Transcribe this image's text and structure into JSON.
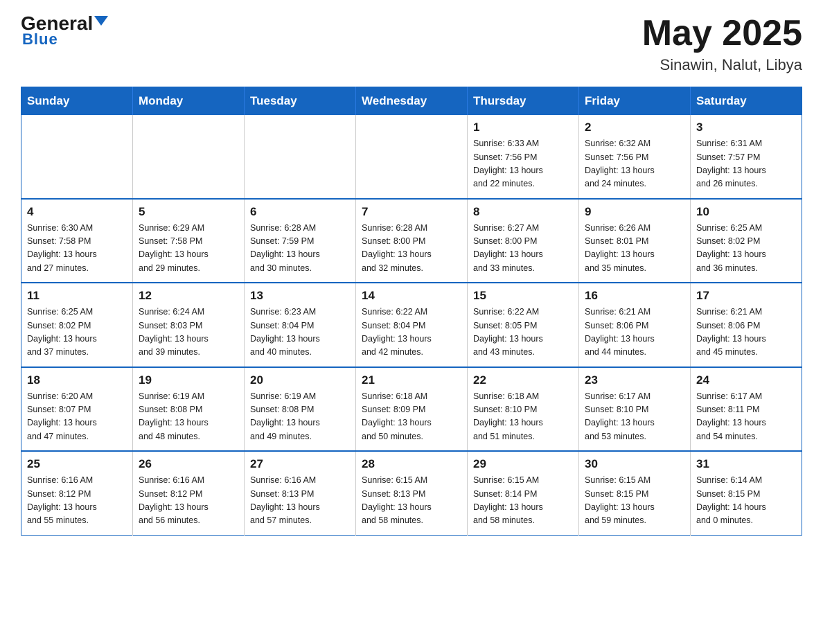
{
  "header": {
    "logo_general": "General",
    "logo_blue": "Blue",
    "title": "May 2025",
    "subtitle": "Sinawin, Nalut, Libya"
  },
  "calendar": {
    "days_of_week": [
      "Sunday",
      "Monday",
      "Tuesday",
      "Wednesday",
      "Thursday",
      "Friday",
      "Saturday"
    ],
    "weeks": [
      [
        {
          "day": "",
          "info": ""
        },
        {
          "day": "",
          "info": ""
        },
        {
          "day": "",
          "info": ""
        },
        {
          "day": "",
          "info": ""
        },
        {
          "day": "1",
          "info": "Sunrise: 6:33 AM\nSunset: 7:56 PM\nDaylight: 13 hours\nand 22 minutes."
        },
        {
          "day": "2",
          "info": "Sunrise: 6:32 AM\nSunset: 7:56 PM\nDaylight: 13 hours\nand 24 minutes."
        },
        {
          "day": "3",
          "info": "Sunrise: 6:31 AM\nSunset: 7:57 PM\nDaylight: 13 hours\nand 26 minutes."
        }
      ],
      [
        {
          "day": "4",
          "info": "Sunrise: 6:30 AM\nSunset: 7:58 PM\nDaylight: 13 hours\nand 27 minutes."
        },
        {
          "day": "5",
          "info": "Sunrise: 6:29 AM\nSunset: 7:58 PM\nDaylight: 13 hours\nand 29 minutes."
        },
        {
          "day": "6",
          "info": "Sunrise: 6:28 AM\nSunset: 7:59 PM\nDaylight: 13 hours\nand 30 minutes."
        },
        {
          "day": "7",
          "info": "Sunrise: 6:28 AM\nSunset: 8:00 PM\nDaylight: 13 hours\nand 32 minutes."
        },
        {
          "day": "8",
          "info": "Sunrise: 6:27 AM\nSunset: 8:00 PM\nDaylight: 13 hours\nand 33 minutes."
        },
        {
          "day": "9",
          "info": "Sunrise: 6:26 AM\nSunset: 8:01 PM\nDaylight: 13 hours\nand 35 minutes."
        },
        {
          "day": "10",
          "info": "Sunrise: 6:25 AM\nSunset: 8:02 PM\nDaylight: 13 hours\nand 36 minutes."
        }
      ],
      [
        {
          "day": "11",
          "info": "Sunrise: 6:25 AM\nSunset: 8:02 PM\nDaylight: 13 hours\nand 37 minutes."
        },
        {
          "day": "12",
          "info": "Sunrise: 6:24 AM\nSunset: 8:03 PM\nDaylight: 13 hours\nand 39 minutes."
        },
        {
          "day": "13",
          "info": "Sunrise: 6:23 AM\nSunset: 8:04 PM\nDaylight: 13 hours\nand 40 minutes."
        },
        {
          "day": "14",
          "info": "Sunrise: 6:22 AM\nSunset: 8:04 PM\nDaylight: 13 hours\nand 42 minutes."
        },
        {
          "day": "15",
          "info": "Sunrise: 6:22 AM\nSunset: 8:05 PM\nDaylight: 13 hours\nand 43 minutes."
        },
        {
          "day": "16",
          "info": "Sunrise: 6:21 AM\nSunset: 8:06 PM\nDaylight: 13 hours\nand 44 minutes."
        },
        {
          "day": "17",
          "info": "Sunrise: 6:21 AM\nSunset: 8:06 PM\nDaylight: 13 hours\nand 45 minutes."
        }
      ],
      [
        {
          "day": "18",
          "info": "Sunrise: 6:20 AM\nSunset: 8:07 PM\nDaylight: 13 hours\nand 47 minutes."
        },
        {
          "day": "19",
          "info": "Sunrise: 6:19 AM\nSunset: 8:08 PM\nDaylight: 13 hours\nand 48 minutes."
        },
        {
          "day": "20",
          "info": "Sunrise: 6:19 AM\nSunset: 8:08 PM\nDaylight: 13 hours\nand 49 minutes."
        },
        {
          "day": "21",
          "info": "Sunrise: 6:18 AM\nSunset: 8:09 PM\nDaylight: 13 hours\nand 50 minutes."
        },
        {
          "day": "22",
          "info": "Sunrise: 6:18 AM\nSunset: 8:10 PM\nDaylight: 13 hours\nand 51 minutes."
        },
        {
          "day": "23",
          "info": "Sunrise: 6:17 AM\nSunset: 8:10 PM\nDaylight: 13 hours\nand 53 minutes."
        },
        {
          "day": "24",
          "info": "Sunrise: 6:17 AM\nSunset: 8:11 PM\nDaylight: 13 hours\nand 54 minutes."
        }
      ],
      [
        {
          "day": "25",
          "info": "Sunrise: 6:16 AM\nSunset: 8:12 PM\nDaylight: 13 hours\nand 55 minutes."
        },
        {
          "day": "26",
          "info": "Sunrise: 6:16 AM\nSunset: 8:12 PM\nDaylight: 13 hours\nand 56 minutes."
        },
        {
          "day": "27",
          "info": "Sunrise: 6:16 AM\nSunset: 8:13 PM\nDaylight: 13 hours\nand 57 minutes."
        },
        {
          "day": "28",
          "info": "Sunrise: 6:15 AM\nSunset: 8:13 PM\nDaylight: 13 hours\nand 58 minutes."
        },
        {
          "day": "29",
          "info": "Sunrise: 6:15 AM\nSunset: 8:14 PM\nDaylight: 13 hours\nand 58 minutes."
        },
        {
          "day": "30",
          "info": "Sunrise: 6:15 AM\nSunset: 8:15 PM\nDaylight: 13 hours\nand 59 minutes."
        },
        {
          "day": "31",
          "info": "Sunrise: 6:14 AM\nSunset: 8:15 PM\nDaylight: 14 hours\nand 0 minutes."
        }
      ]
    ]
  }
}
